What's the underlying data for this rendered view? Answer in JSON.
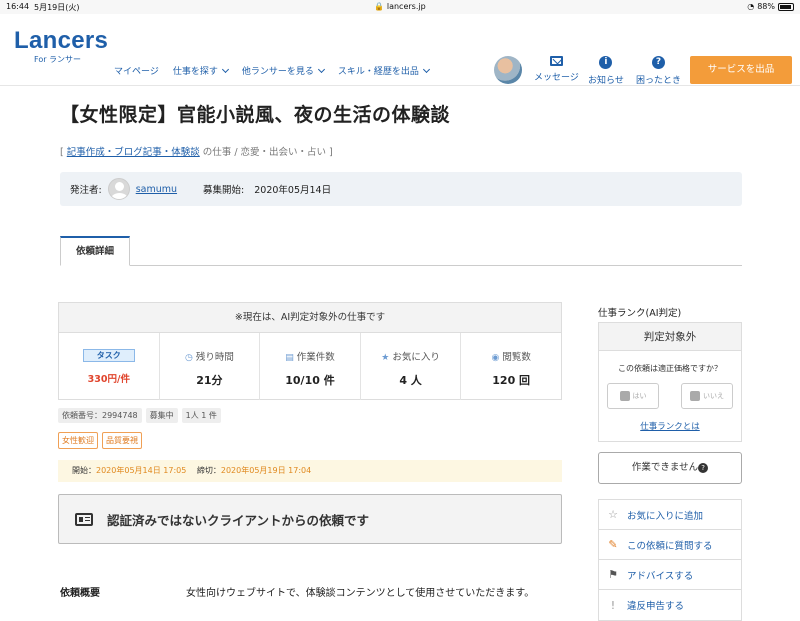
{
  "status_bar": {
    "time": "16:44",
    "date": "5月19日(火)",
    "url": "lancers.jp",
    "battery": "88%"
  },
  "header": {
    "logo_name": "Lancers",
    "logo_sub": "For ランサー",
    "nav": [
      "マイページ",
      "仕事を探す",
      "他ランサーを見る",
      "スキル・経歴を出品"
    ],
    "icons": {
      "messages": "メッセージ",
      "notices": "お知らせ",
      "help": "困ったとき"
    },
    "sell_button": "サービスを出品"
  },
  "job": {
    "title": "【女性限定】官能小説風、夜の生活の体験談",
    "crumb_open": "[",
    "crumb_link": "記事作成・ブログ記事・体験談",
    "crumb_rest": "の仕事 / 恋愛・出会い・占い ]",
    "poster_label": "発注者:",
    "poster_name": "samumu",
    "start_label": "募集開始:",
    "start_date": "2020年05月14日"
  },
  "tabs": {
    "active": "依頼詳細"
  },
  "stats": {
    "notice": "※現在は、AI判定対象外の仕事です",
    "task_badge": "タスク",
    "price": "330円/件",
    "remaining_label": "残り時間",
    "remaining_value": "21分",
    "works_label": "作業件数",
    "works_value": "10/10 件",
    "favorites_label": "お気に入り",
    "favorites_value": "4 人",
    "views_label": "閲覧数",
    "views_value": "120 回"
  },
  "meta": {
    "request_no": "依頼番号：2994748",
    "status": "募集中",
    "per_person": "1人 1 件"
  },
  "tags": [
    "女性歓迎",
    "品質要視"
  ],
  "dates": {
    "start_label": "開始：",
    "start": "2020年05月14日 17:05",
    "end_label": "締切：",
    "end": "2020年05月19日 17:04"
  },
  "cert_notice": "認証済みではないクライアントからの依頼です",
  "overview": {
    "label": "依頼概要",
    "text": "女性向けウェブサイトで、体験談コンテンツとして使用させていただきます。"
  },
  "sidebar": {
    "rank_label": "仕事ランク(AI判定)",
    "rank_value": "判定対象外",
    "question": "この依頼は適正価格ですか？",
    "yes": "はい",
    "no": "いいえ",
    "rank_link": "仕事ランクとは",
    "cannot_work": "作業できません",
    "actions": [
      "お気に入りに追加",
      "この依頼に質問する",
      "アドバイスする",
      "違反申告する"
    ]
  },
  "colors": {
    "brand": "#1f5fa9",
    "accent": "#f39c3a",
    "price": "#e0442c"
  }
}
